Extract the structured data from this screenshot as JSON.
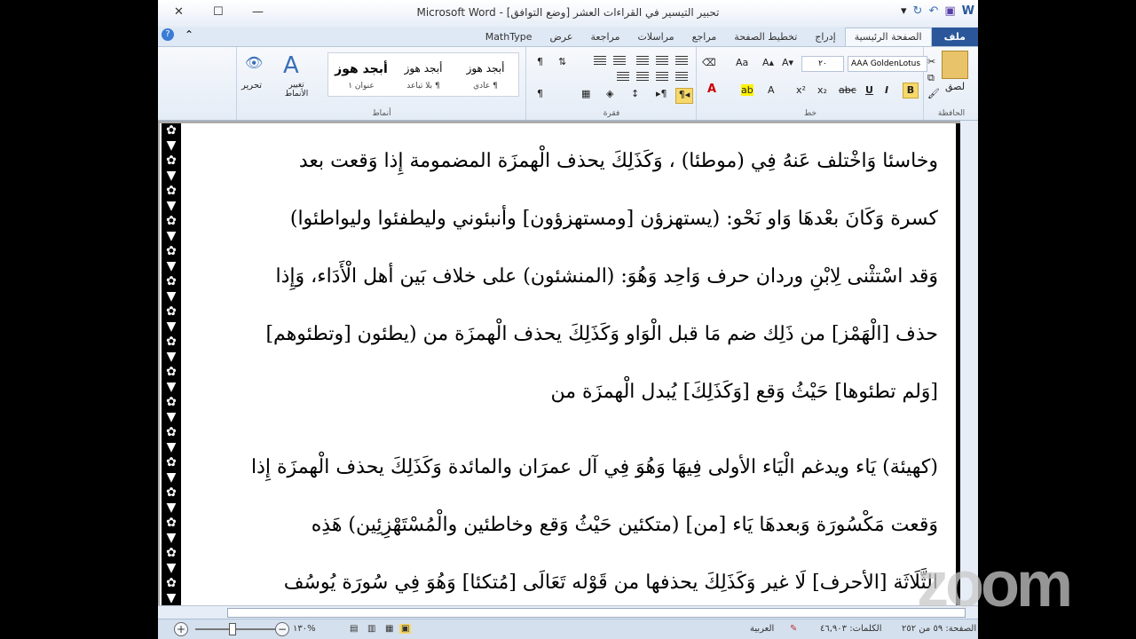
{
  "window": {
    "title": "تحبير التيسير في القراءات العشر [وضع التوافق] - Microsoft Word"
  },
  "tabs": [
    {
      "label": "ملف",
      "kind": "file"
    },
    {
      "label": "الصفحة الرئيسية",
      "kind": "active"
    },
    {
      "label": "إدراج",
      "kind": ""
    },
    {
      "label": "تخطيط الصفحة",
      "kind": ""
    },
    {
      "label": "مراجع",
      "kind": ""
    },
    {
      "label": "مراسلات",
      "kind": ""
    },
    {
      "label": "مراجعة",
      "kind": ""
    },
    {
      "label": "عرض",
      "kind": ""
    },
    {
      "label": "MathType",
      "kind": ""
    }
  ],
  "ribbon": {
    "clipboard": {
      "paste_label": "لصق",
      "group_label": "الحافظة"
    },
    "font": {
      "font_name": "AAA GoldenLotus",
      "font_size": "٢٠",
      "group_label": "خط"
    },
    "paragraph": {
      "group_label": "فقرة"
    },
    "styles": {
      "group_label": "أنماط",
      "tiles": [
        {
          "sample": "أبجد هوز",
          "name": "¶ عادي"
        },
        {
          "sample": "أبجد هوز",
          "name": "¶ بلا تباعد"
        },
        {
          "sample": "أبجد هوز",
          "name": "عنوان ١"
        }
      ],
      "change_styles_label": "تغيير الأنماط"
    },
    "editing": {
      "label": "تحرير"
    }
  },
  "document": {
    "lines": [
      "وخاسئا وَاخْتلف عَنهُ فِي (موطئا) ، وَكَذَلِكَ يحذف الْهمزَة المضمومة إِذا وَقعت بعد",
      "كسرة وَكَانَ بعْدهَا وَاو نَحْو: (يستهزؤن [ومستهزؤون] وأنبئوني وليطفئوا وليواطئوا)",
      "وَقد اسْتثْنى لِابْنِ وردان حرف وَاحِد وَهُوَ: (المنشئون) على خلاف بَين أهل الْأَدَاء، وَإِذا",
      "حذف [الْهَمْز] من ذَلِك ضم مَا قبل الْوَاو وَكَذَلِكَ يحذف الْهمزَة من (يطئون [وتطئوهم]",
      "[وَلم تطئوها] حَيْثُ وَقع [وَكَذَلِكَ] يُبدل الْهمزَة من",
      "(كهيئة) يَاء ويدغم الْيَاء الأولى فِيهَا وَهُوَ فِي آل عمرَان والمائدة وَكَذَلِكَ يحذف الْهمزَة إِذا",
      "وَقعت مَكْسُورَة وَبعدهَا يَاء [من] (متكئين حَيْثُ وَقع وخاطئين والْمُسْتَهْزِئِين) هَذِه",
      "الثَّلَاثَة [الأحرف] لَا غير وَكَذَلِكَ يحذفها من قَوْله تَعَالَى [مُتكئا] وَهُوَ فِي سُورَة يُوسُف"
    ]
  },
  "status": {
    "page": "الصفحة: ٥٩ من ٢٥٢",
    "words": "الكلمات: ٤٦,٩٠٣",
    "language": "العربية",
    "zoom": "%١٣٠"
  },
  "watermark": "zoom"
}
